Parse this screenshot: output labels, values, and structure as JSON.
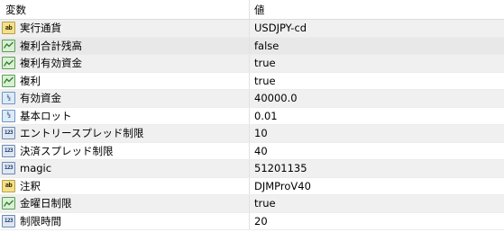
{
  "columns": {
    "name": "変数",
    "value": "値"
  },
  "rows": [
    {
      "icon": "string-type-icon",
      "kind": "str",
      "name": "実行通貨",
      "value": "USDJPY-cd"
    },
    {
      "icon": "bool-type-icon",
      "kind": "bool",
      "name": "複利合計残高",
      "value": "false"
    },
    {
      "icon": "bool-type-icon",
      "kind": "bool",
      "name": "複利有効資金",
      "value": "true"
    },
    {
      "icon": "bool-type-icon",
      "kind": "bool",
      "name": "複利",
      "value": "true"
    },
    {
      "icon": "double-type-icon",
      "kind": "dbl",
      "name": "有効資金",
      "value": "40000.0"
    },
    {
      "icon": "double-type-icon",
      "kind": "dbl",
      "name": "基本ロット",
      "value": "0.01"
    },
    {
      "icon": "int-type-icon",
      "kind": "int",
      "name": "エントリースプレッド制限",
      "value": "10"
    },
    {
      "icon": "int-type-icon",
      "kind": "int",
      "name": "決済スプレッド制限",
      "value": "40"
    },
    {
      "icon": "int-type-icon",
      "kind": "int",
      "name": "magic",
      "value": "51201135"
    },
    {
      "icon": "string-type-icon",
      "kind": "str",
      "name": "注釈",
      "value": "DJMProV40"
    },
    {
      "icon": "bool-type-icon",
      "kind": "bool",
      "name": "金曜日制限",
      "value": "true"
    },
    {
      "icon": "int-type-icon",
      "kind": "int",
      "name": "制限時間",
      "value": "20"
    }
  ],
  "icon_glyphs": {
    "str": "ab",
    "dbl": "½",
    "int": "123"
  },
  "colors": {
    "selected_row": "#e8e8e8",
    "alt_row": "#f0f0f0"
  }
}
